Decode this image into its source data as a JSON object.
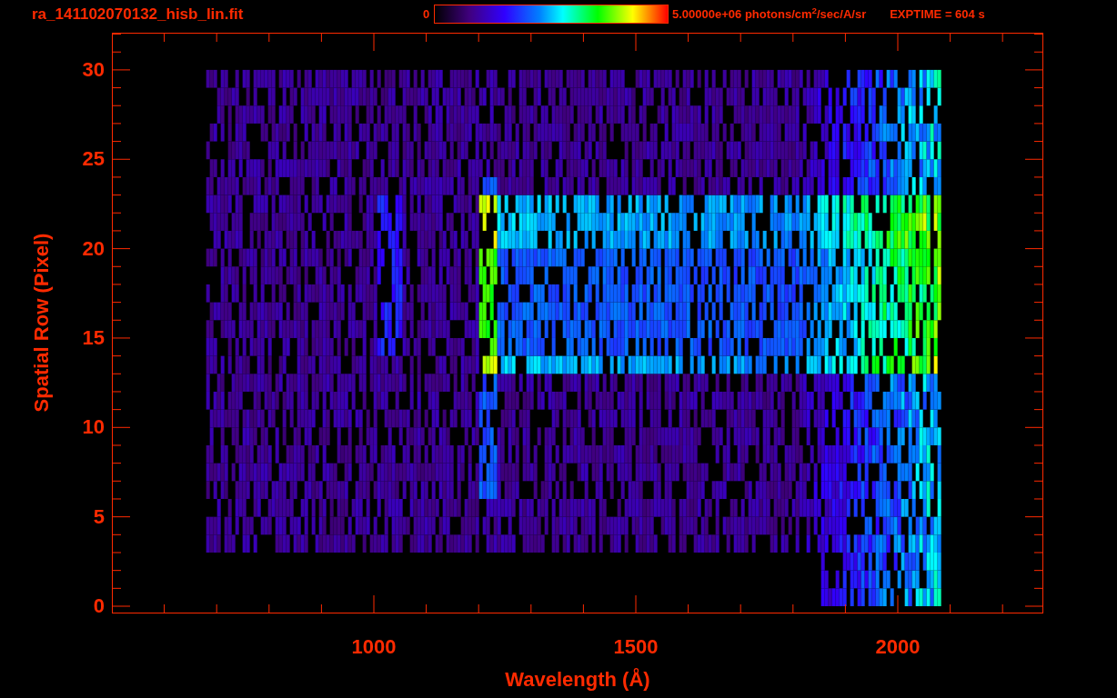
{
  "title": "ra_141102070132_hisb_lin.fit",
  "colorbar": {
    "min_label": "0",
    "max_label": "5.00000e+06 photons/cm$^{2}$/sec/A/sr"
  },
  "exptime": "EXPTIME = 604 s",
  "plot": {
    "ylabel": "Spatial Row (Pixel)",
    "xlabel": "Wavelength (Å)",
    "yticks": [
      "30",
      "25",
      "20",
      "15",
      "10",
      "5",
      "0"
    ],
    "xticks": [
      "1000",
      "1500",
      "2000"
    ]
  }
}
